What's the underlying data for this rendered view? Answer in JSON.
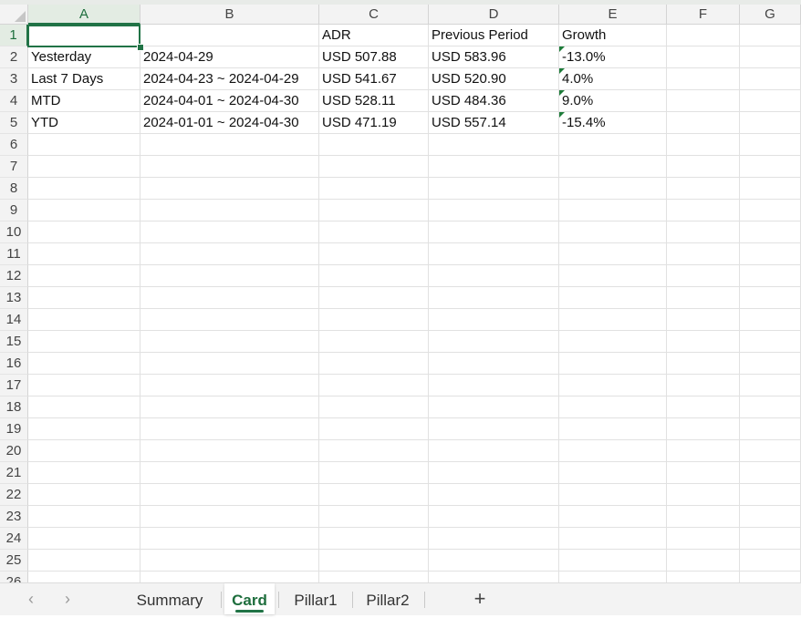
{
  "columns": [
    "A",
    "B",
    "C",
    "D",
    "E",
    "F",
    "G"
  ],
  "rows": [
    "1",
    "2",
    "3",
    "4",
    "5",
    "6",
    "7",
    "8",
    "9",
    "10",
    "11",
    "12",
    "13",
    "14",
    "15",
    "16",
    "17",
    "18",
    "19",
    "20",
    "21",
    "22",
    "23",
    "24",
    "25",
    "26"
  ],
  "cells": {
    "C1": "ADR",
    "D1": "Previous Period",
    "E1": "Growth",
    "A2": "Yesterday",
    "B2": "2024-04-29",
    "C2": "USD 507.88",
    "D2": "USD 583.96",
    "E2": "-13.0%",
    "A3": "Last 7 Days",
    "B3": "2024-04-23 ~ 2024-04-29",
    "C3": "USD 541.67",
    "D3": "USD 520.90",
    "E3": "4.0%",
    "A4": "MTD",
    "B4": "2024-04-01 ~ 2024-04-30",
    "C4": "USD 528.11",
    "D4": "USD 484.36",
    "E4": "9.0%",
    "A5": "YTD",
    "B5": "2024-01-01 ~ 2024-04-30",
    "C5": "USD 471.19",
    "D5": "USD 557.14",
    "E5": "-15.4%"
  },
  "selected_cell": "A1",
  "sheet_tabs": [
    {
      "label": "Summary",
      "active": false
    },
    {
      "label": "Card",
      "active": true
    },
    {
      "label": "Pillar1",
      "active": false
    },
    {
      "label": "Pillar2",
      "active": false
    }
  ],
  "icons": {
    "prev": "‹",
    "next": "›",
    "add": "+"
  },
  "colors": {
    "accent": "#217346",
    "header_bg": "#f3f3f3",
    "gridline": "#e1e1e1"
  }
}
